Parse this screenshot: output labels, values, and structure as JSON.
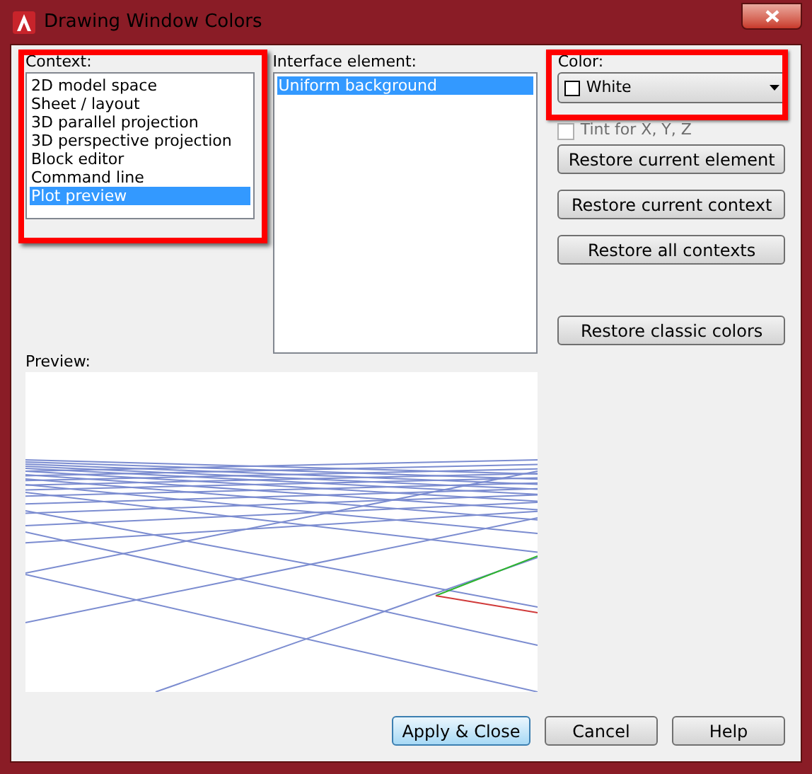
{
  "window": {
    "title": "Drawing Window Colors"
  },
  "context": {
    "label": "Context:",
    "items": [
      {
        "label": "2D model space",
        "selected": false
      },
      {
        "label": "Sheet / layout",
        "selected": false
      },
      {
        "label": "3D parallel projection",
        "selected": false
      },
      {
        "label": "3D perspective projection",
        "selected": false
      },
      {
        "label": "Block editor",
        "selected": false
      },
      {
        "label": "Command line",
        "selected": false
      },
      {
        "label": "Plot preview",
        "selected": true
      }
    ]
  },
  "interface_element": {
    "label": "Interface element:",
    "items": [
      {
        "label": "Uniform background",
        "selected": true
      }
    ]
  },
  "color": {
    "label": "Color:",
    "value": "White"
  },
  "tint": {
    "label": "Tint for X, Y, Z",
    "checked": false,
    "disabled": true
  },
  "side_buttons": [
    "Restore current element",
    "Restore current context",
    "Restore all contexts",
    "Restore classic colors"
  ],
  "preview": {
    "label": "Preview:"
  },
  "buttons": [
    {
      "label": "Apply & Close",
      "default": true
    },
    {
      "label": "Cancel",
      "default": false
    },
    {
      "label": "Help",
      "default": false
    }
  ]
}
